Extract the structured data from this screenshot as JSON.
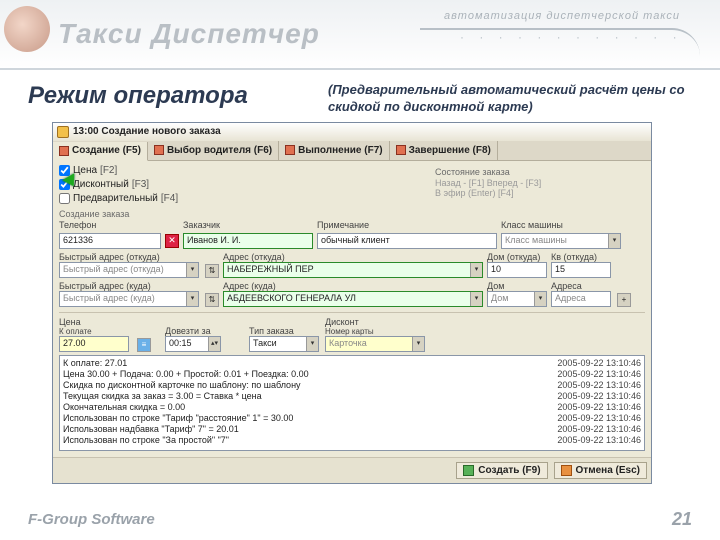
{
  "slide": {
    "brand": "Такси Диспетчер",
    "tagline": "автоматизация диспетчерской такси",
    "title": "Режим оператора",
    "subtitle": "(Предварительный автоматический расчёт цены со скидкой по дисконтной карте)",
    "company": "F-Group Software",
    "page": "21"
  },
  "window": {
    "title": "13:00 Создание нового заказа",
    "tabs": [
      {
        "label": "Создание (F5)"
      },
      {
        "label": "Выбор водителя (F6)"
      },
      {
        "label": "Выполнение (F7)"
      },
      {
        "label": "Завершение (F8)"
      }
    ],
    "checks": {
      "price_label": "Цена",
      "price_hk": "[F2]",
      "discount_label": "Дисконтный",
      "discount_hk": "[F3]",
      "prelim_label": "Предварительный",
      "prelim_hk": "[F4]"
    },
    "state": {
      "header": "Состояние заказа",
      "back": "Назад - [F1]  Вперед - [F3]",
      "ready": "В эфир (Enter)           [F4]"
    },
    "fields": {
      "row1": {
        "phone_l": "Телефон",
        "phone_v": "621336",
        "client_l": "Заказчик",
        "client_v": "Иванов И. И.",
        "note_l": "Примечание",
        "note_v": "обычный клиент",
        "class_l": "Класс машины",
        "class_v": "Класс машины"
      },
      "row2": {
        "qfrom_l": "Быстрый адрес (откуда)",
        "qfrom_v": "Быстрый адрес (откуда)",
        "afrom_l": "Адрес (откуда)",
        "afrom_v": "НАБЕРЕЖНЫЙ ПЕР",
        "house_l": "Дом (откуда)",
        "house_v": "10",
        "flat_l": "Кв (откуда)",
        "flat_v": "15"
      },
      "row3": {
        "qto_l": "Быстрый адрес (куда)",
        "qto_v": "Быстрый адрес (куда)",
        "ato_l": "Адрес (куда)",
        "ato_v": "АБДЕЕВСКОГО ГЕНЕРАЛА УЛ",
        "hto_l": "Дом",
        "hto_v": "Дом",
        "addr2_l": "Адреса",
        "addr2_v": "Адреса"
      },
      "row4": {
        "price_l": "Цена",
        "price_sub": "К оплате",
        "price_v": "27.00",
        "wait_l": "Довезти за",
        "wait_v": "00:15",
        "type_l": "Тип заказа",
        "type_v": "Такси",
        "disc_l": "Дисконт",
        "card_l": "Номер карты",
        "card_v": "Карточка"
      }
    },
    "log": [
      {
        "t": "К оплате: 27.01",
        "ts": "2005-09-22 13:10:46"
      },
      {
        "t": "Цена 30.00 + Подача: 0.00 + Простой: 0.01 + Поездка: 0.00",
        "ts": "2005-09-22 13:10:46"
      },
      {
        "t": "Скидка по дисконтной карточке по шаблону: по шаблону",
        "ts": "2005-09-22 13:10:46"
      },
      {
        "t": "Текущая скидка за заказ = 3.00 = Ставка * цена",
        "ts": "2005-09-22 13:10:46"
      },
      {
        "t": "Окончательная скидка = 0.00",
        "ts": "2005-09-22 13:10:46"
      },
      {
        "t": "Использован по строке \"Тариф \"расстояние\" 1\" = 30.00",
        "ts": "2005-09-22 13:10:46"
      },
      {
        "t": "Использован надбавка \"Тариф\" 7\" = 20.01",
        "ts": "2005-09-22 13:10:46"
      },
      {
        "t": "Использован по строке \"За простой\" \"7\"",
        "ts": "2005-09-22 13:10:46"
      }
    ],
    "buttons": {
      "create": "Создать (F9)",
      "cancel": "Отмена (Esc)"
    }
  }
}
